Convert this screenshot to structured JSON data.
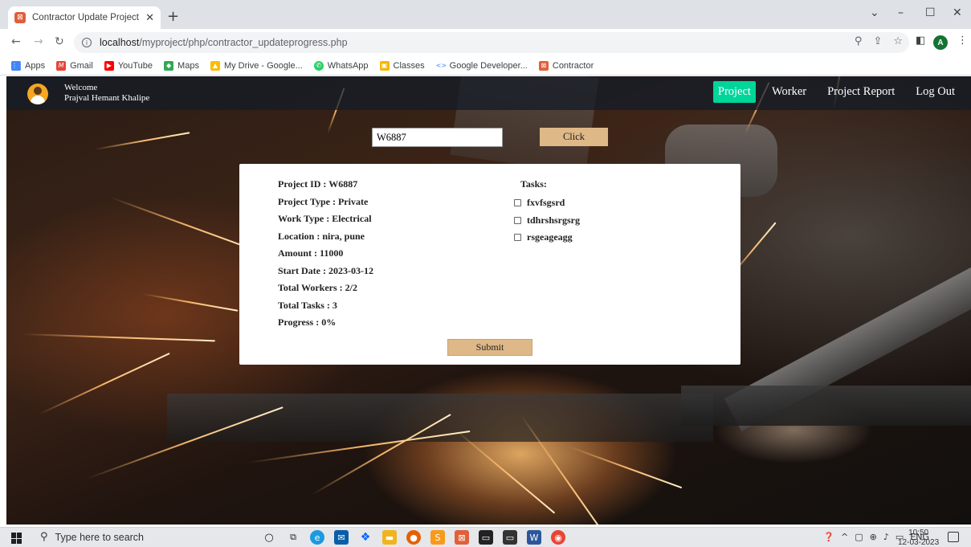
{
  "browser": {
    "tab_title": "Contractor Update Project Progr",
    "tab_favicon": "contractor-favicon",
    "url_host": "localhost",
    "url_path": "/myproject/php/contractor_updateprogress.php",
    "profile_initial": "A",
    "bookmarks": [
      "Apps",
      "Gmail",
      "YouTube",
      "Maps",
      "My Drive - Google...",
      "WhatsApp",
      "Classes",
      "Google Developer...",
      "Contractor"
    ]
  },
  "navbar": {
    "welcome": "Welcome",
    "user_name": "Prajval Hemant Khalipe",
    "links": [
      "Project",
      "Worker",
      "Project Report",
      "Log Out"
    ],
    "active_link": "Project",
    "active_color": "#00d59a"
  },
  "search": {
    "value": "W6887",
    "button_label": "Click",
    "button_color": "#deb887"
  },
  "project": {
    "id_label": "Project ID : W6887",
    "type_label": "Project Type : Private",
    "work_type_label": "Work Type : Electrical",
    "location_label": "Location : nira, pune",
    "amount_label": "Amount : 11000",
    "start_date_label": "Start Date : 2023-03-12",
    "total_workers_label": "Total Workers : 2/2",
    "total_tasks_label": "Total Tasks : 3",
    "progress_label": "Progress : 0%"
  },
  "tasks": {
    "title": "Tasks:",
    "items": [
      "fxvfsgsrd",
      "tdhrshsrgsrg",
      "rsgeageagg"
    ]
  },
  "submit_label": "Submit",
  "taskbar": {
    "search_placeholder": "Type here to search",
    "language": "ENG",
    "time": "10:50",
    "date": "12-03-2023"
  }
}
